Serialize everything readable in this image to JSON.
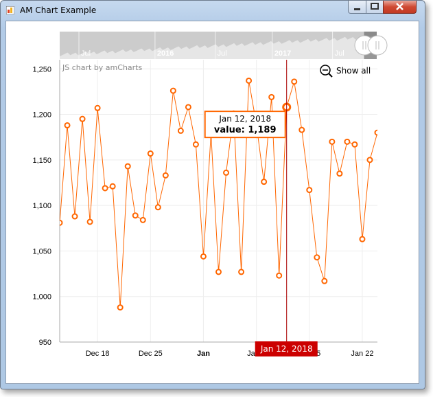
{
  "window": {
    "title": "AM Chart Example"
  },
  "chart_data": {
    "type": "line",
    "title": "",
    "xlabel": "",
    "ylabel": "",
    "credit": "JS chart by amCharts",
    "zoom_out_label": "Show all",
    "ylim": [
      950,
      1260
    ],
    "y_ticks": [
      "950",
      "1,000",
      "1,050",
      "1,100",
      "1,150",
      "1,200",
      "1,250"
    ],
    "x_ticks": [
      {
        "label": "Dec 18",
        "date": "2017-12-18",
        "bold": false
      },
      {
        "label": "Dec 25",
        "date": "2017-12-25",
        "bold": false
      },
      {
        "label": "Jan",
        "date": "2018-01-01",
        "bold": true
      },
      {
        "label": "Jan 8",
        "date": "2018-01-08",
        "bold": false
      },
      {
        "label": "Jan 15",
        "date": "2018-01-15",
        "bold": false
      },
      {
        "label": "Jan 22",
        "date": "2018-01-22",
        "bold": false
      }
    ],
    "visible_range": [
      "2017-12-13",
      "2018-01-24"
    ],
    "series": [
      {
        "color": "#ff6600",
        "x": [
          "2017-12-13",
          "2017-12-14",
          "2017-12-15",
          "2017-12-16",
          "2017-12-17",
          "2017-12-18",
          "2017-12-19",
          "2017-12-20",
          "2017-12-21",
          "2017-12-22",
          "2017-12-23",
          "2017-12-24",
          "2017-12-25",
          "2017-12-26",
          "2017-12-27",
          "2017-12-28",
          "2017-12-29",
          "2017-12-30",
          "2017-12-31",
          "2018-01-01",
          "2018-01-02",
          "2018-01-03",
          "2018-01-04",
          "2018-01-05",
          "2018-01-06",
          "2018-01-07",
          "2018-01-08",
          "2018-01-09",
          "2018-01-10",
          "2018-01-11",
          "2018-01-12",
          "2018-01-13",
          "2018-01-14",
          "2018-01-15",
          "2018-01-16",
          "2018-01-17",
          "2018-01-18",
          "2018-01-19",
          "2018-01-20",
          "2018-01-21",
          "2018-01-22",
          "2018-01-23",
          "2018-01-24"
        ],
        "values": [
          1081,
          1188,
          1088,
          1195,
          1082,
          1207,
          1119,
          1121,
          988,
          1143,
          1089,
          1084,
          1157,
          1098,
          1133,
          1226,
          1182,
          1208,
          1167,
          1044,
          1179,
          1027,
          1136,
          1201,
          1027,
          1237,
          1189,
          1126,
          1219,
          1023,
          1208,
          1236,
          1183,
          1117,
          1043,
          1017,
          1170,
          1135,
          1170,
          1167,
          1063,
          1150,
          1180
        ]
      }
    ],
    "cursor": {
      "date_label": "Jan 12, 2018",
      "balloon_date": "Jan 12, 2018",
      "balloon_value": "value: 1,189",
      "date": "2018-01-12",
      "value": 1189
    },
    "scrollbar": {
      "labels": [
        {
          "label": "Jul",
          "bold": false
        },
        {
          "label": "2016",
          "bold": true
        },
        {
          "label": "Jul",
          "bold": false
        },
        {
          "label": "2017",
          "bold": true
        },
        {
          "label": "Jul",
          "bold": false
        }
      ],
      "selected_fraction": [
        0.96,
        1.0
      ]
    },
    "grid": true,
    "colors": {
      "line": "#ff6600",
      "cursor": "#cc0000",
      "scrollbar_bg": "#cccccc",
      "scrollbar_area": "#e6e6e6"
    }
  }
}
